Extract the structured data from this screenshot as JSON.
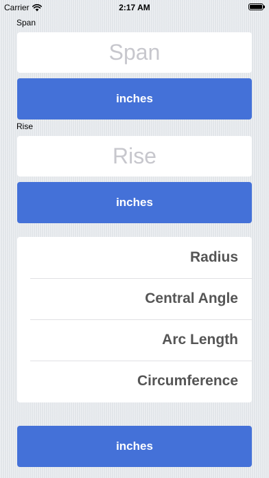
{
  "status_bar": {
    "carrier": "Carrier",
    "time": "2:17 AM",
    "wifi_icon": "wifi-icon",
    "battery_icon": "battery-full-icon"
  },
  "span": {
    "label": "Span",
    "placeholder": "Span",
    "value": "",
    "unit_button": "inches"
  },
  "rise": {
    "label": "Rise",
    "placeholder": "Rise",
    "value": "",
    "unit_button": "inches"
  },
  "results": {
    "items": [
      {
        "label": "Radius"
      },
      {
        "label": "Central Angle"
      },
      {
        "label": "Arc Length"
      },
      {
        "label": "Circumference"
      }
    ]
  },
  "output_unit_button": "inches",
  "colors": {
    "accent": "#4471d8",
    "background": "#e6eaee",
    "result_text": "#555555",
    "placeholder": "#c7c7cd"
  }
}
